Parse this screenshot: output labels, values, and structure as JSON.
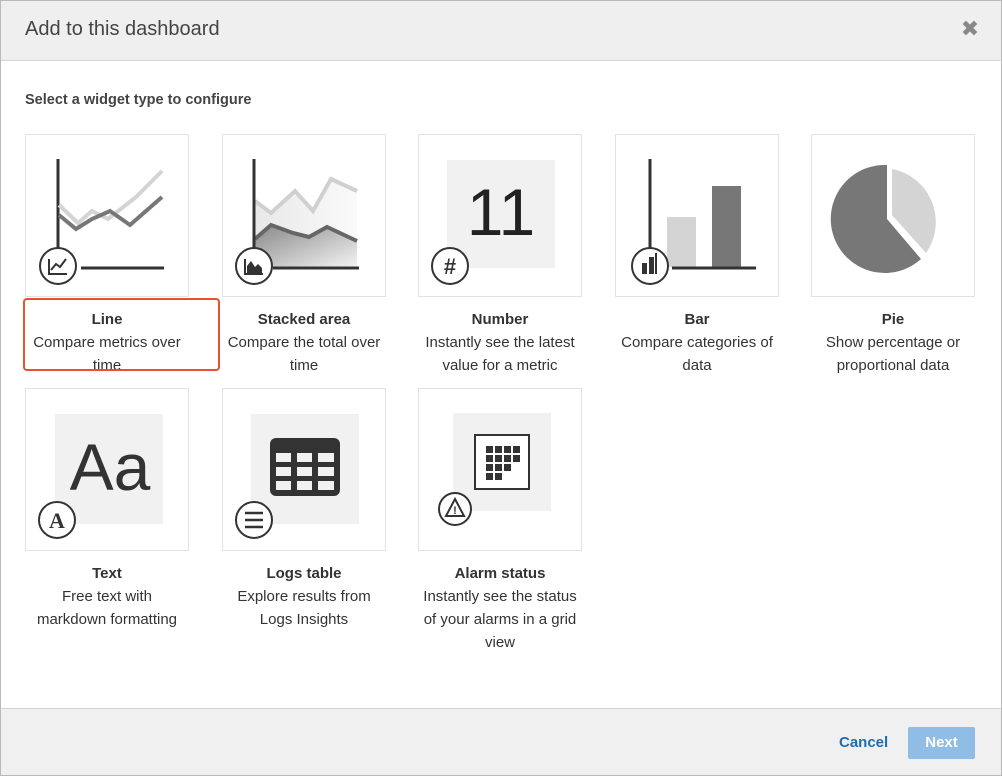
{
  "dialog": {
    "title": "Add to this dashboard",
    "close_glyph": "✖",
    "subtitle": "Select a widget type to configure"
  },
  "widgets": [
    {
      "name": "Line",
      "description": "Compare metrics over time",
      "icon": "line-chart-icon",
      "selected": true
    },
    {
      "name": "Stacked area",
      "description": "Compare the total over time",
      "icon": "area-chart-icon",
      "selected": false
    },
    {
      "name": "Number",
      "description": "Instantly see the latest value for a metric",
      "icon": "hash-icon",
      "preview_text": "11",
      "badge_glyph": "#",
      "selected": false
    },
    {
      "name": "Bar",
      "description": "Compare categories of data",
      "icon": "bar-chart-icon",
      "selected": false
    },
    {
      "name": "Pie",
      "description": "Show percentage or proportional data",
      "icon": "pie-chart-icon",
      "selected": false
    },
    {
      "name": "Text",
      "description": "Free text with markdown formatting",
      "icon": "text-icon",
      "preview_text": "Aa",
      "badge_glyph": "A",
      "selected": false
    },
    {
      "name": "Logs table",
      "description": "Explore results from Logs Insights",
      "icon": "list-icon",
      "selected": false
    },
    {
      "name": "Alarm status",
      "description": "Instantly see the status of your alarms in a grid view",
      "icon": "warning-icon",
      "badge_glyph": "!",
      "selected": false
    }
  ],
  "footer": {
    "cancel_label": "Cancel",
    "next_label": "Next"
  },
  "colors": {
    "accent": "#e8502e",
    "link": "#1a6fb4",
    "next_disabled": "#8fbde6"
  }
}
